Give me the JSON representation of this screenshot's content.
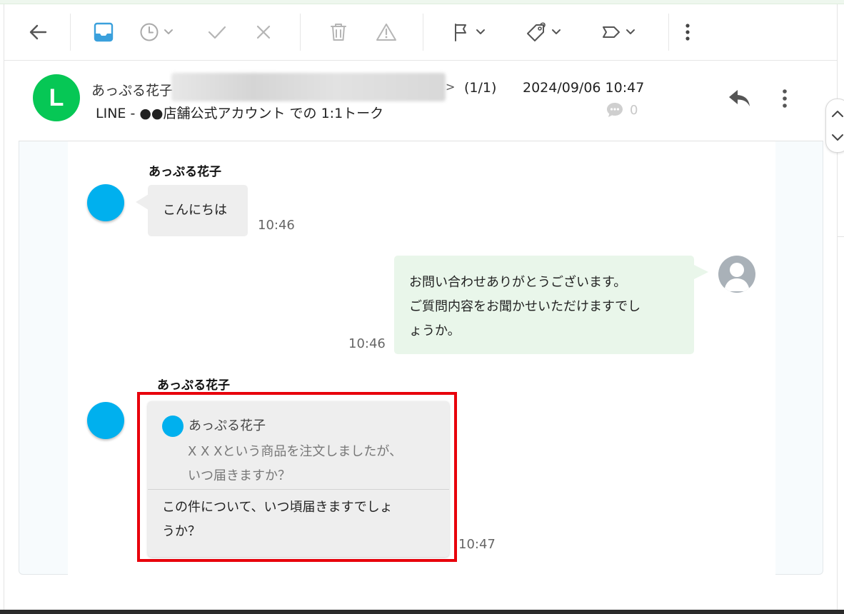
{
  "toolbar": {
    "back": "arrow-left-icon",
    "inbox": "inbox-icon",
    "snooze": "clock-icon",
    "done": "check-icon",
    "close": "close-icon",
    "delete": "trash-icon",
    "spam": "warning-icon",
    "flag": "flag-icon",
    "tag": "tag-icon",
    "label": "label-icon",
    "more": "more-vertical-icon",
    "accent": "#3aa0dc"
  },
  "header": {
    "avatar_letter": "L",
    "avatar_color": "#06c755",
    "sender_name": "あっぷる花子",
    "address_tail": ">",
    "count": "(1/1)",
    "datetime": "2024/09/06 10:47",
    "subject": "LINE - ●●店舗公式アカウント での 1:1トーク",
    "comment_count": "0"
  },
  "messages": [
    {
      "side": "left",
      "name": "あっぷる花子",
      "text": "こんにちは",
      "time": "10:46"
    },
    {
      "side": "right",
      "lines": [
        "お問い合わせありがとうございます。",
        "ご質問内容をお聞かせいただけますでし",
        "ょうか。"
      ],
      "time": "10:46"
    },
    {
      "side": "left",
      "name": "あっぷる花子",
      "quote": {
        "name": "あっぷる花子",
        "lines": [
          "X X Xという商品を注文しましたが、",
          "いつ届きますか？"
        ]
      },
      "reply_lines": [
        "この件について、いつ頃届きますでしょ",
        "うか？"
      ],
      "time": "10:47"
    }
  ],
  "colors": {
    "user_avatar": "#00b0ee",
    "highlight": "#e8000b",
    "right_bubble": "#e9f6ea",
    "left_bubble": "#eeeeee"
  }
}
